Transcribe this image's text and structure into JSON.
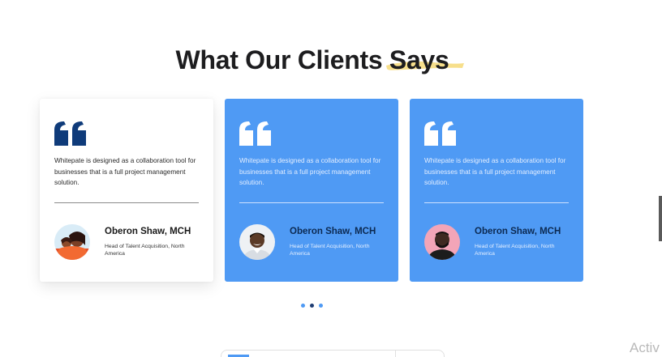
{
  "section": {
    "title_main": "What Our Clients ",
    "title_highlight": "Says"
  },
  "colors": {
    "accent_blue": "#4f9af4",
    "dark_navy": "#0c2a52",
    "highlight_yellow": "#f6d977"
  },
  "testimonials": [
    {
      "variant": "white",
      "icon": "quote-icon",
      "text": "Whitepate is designed as a collaboration tool for businesses that is a full project management solution.",
      "name": "Oberon Shaw, MCH",
      "role": "Head of Talent Acquisition, North America",
      "avatar": "avatar-woman-icon"
    },
    {
      "variant": "blue",
      "icon": "quote-icon",
      "text": "Whitepate is designed as a collaboration tool for businesses that is a full project management solution.",
      "name": "Oberon Shaw, MCH",
      "role": "Head of Talent Acquisition, North America",
      "avatar": "avatar-man-smiling-icon"
    },
    {
      "variant": "blue",
      "icon": "quote-icon",
      "text": "Whitepate is designed as a collaboration tool for businesses that is a full project management solution.",
      "name": "Oberon Shaw, MCH",
      "role": "Head of Talent Acquisition, North America",
      "avatar": "avatar-man-beard-icon"
    }
  ],
  "carousel": {
    "dot_count": 3,
    "active_index": 1
  },
  "watermark": "Activ"
}
